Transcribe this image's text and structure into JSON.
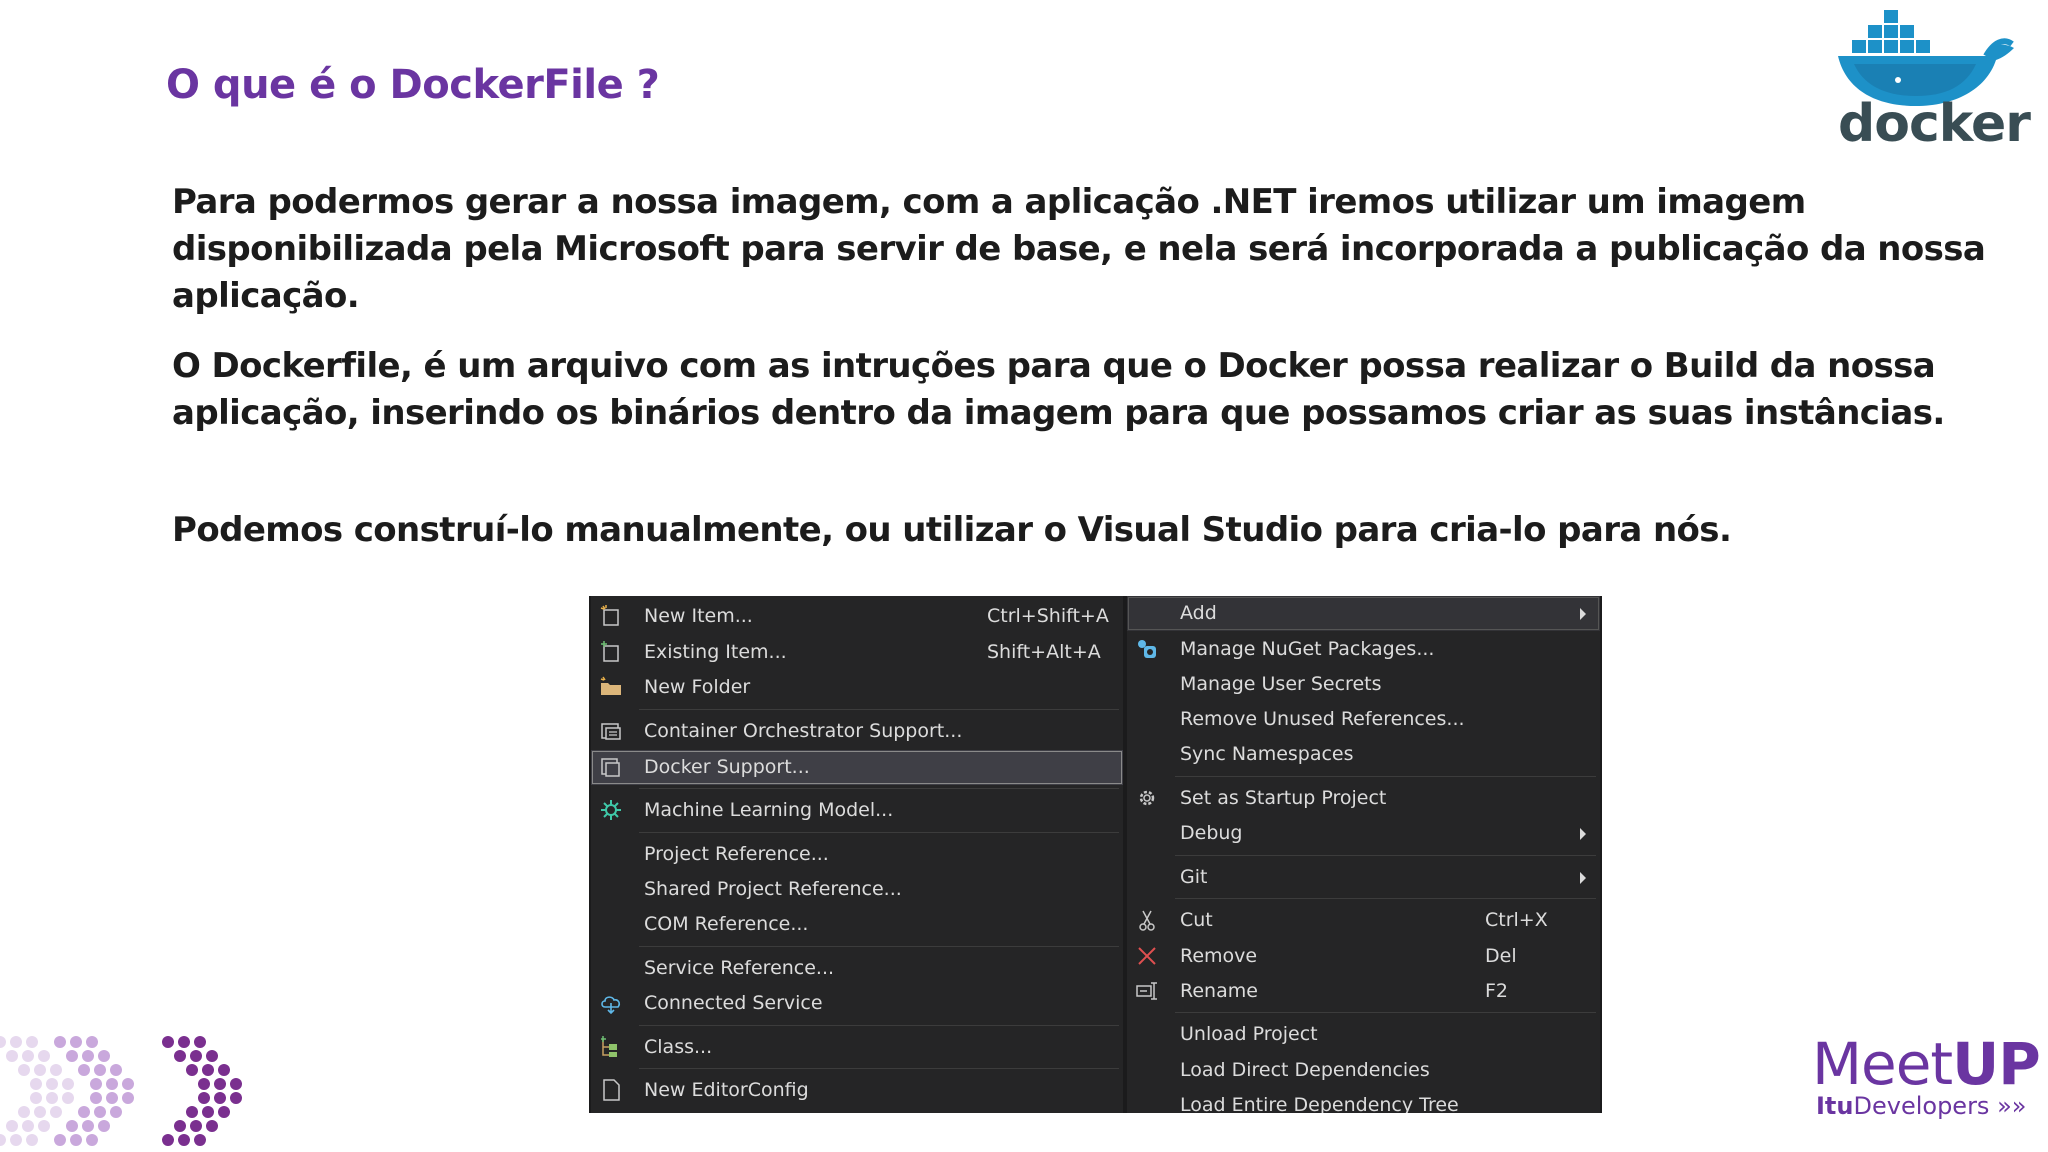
{
  "slide": {
    "title": "O que é o DockerFile ?",
    "paragraphs": [
      "Para podermos gerar a nossa imagem, com a aplicação .NET iremos utilizar um imagem disponibilizada pela Microsoft para servir de base, e nela será incorporada a publicação da nossa aplicação.",
      "O Dockerfile, é um arquivo com as intruções para que o Docker possa realizar o Build da nossa aplicação, inserindo os binários dentro da imagem para que possamos criar as suas instâncias.",
      "Podemos construí-lo manualmente, ou utilizar o Visual Studio para cria-lo para nós."
    ]
  },
  "logos": {
    "docker_word": "docker",
    "meetup_left": "Meet",
    "meetup_right": "UP",
    "itu_bold": "Itu",
    "itu_rest": "Developers"
  },
  "colors": {
    "accent": "#6a35a1",
    "docker_blue": "#1d91c8",
    "menu_bg": "#252526"
  },
  "menu": {
    "left": [
      {
        "label": "New Item...",
        "shortcut": "Ctrl+Shift+A",
        "icon": "new-item-icon"
      },
      {
        "label": "Existing Item...",
        "shortcut": "Shift+Alt+A",
        "icon": "existing-item-icon"
      },
      {
        "label": "New Folder",
        "shortcut": "",
        "icon": "folder-icon"
      },
      {
        "label": "Container Orchestrator Support...",
        "shortcut": "",
        "icon": "container-icon"
      },
      {
        "label": "Docker Support...",
        "shortcut": "",
        "icon": "docker-support-icon",
        "selected": true
      },
      {
        "label": "Machine Learning Model...",
        "shortcut": "",
        "icon": "ml-model-icon"
      },
      {
        "label": "Project Reference...",
        "shortcut": ""
      },
      {
        "label": "Shared Project Reference...",
        "shortcut": ""
      },
      {
        "label": "COM Reference...",
        "shortcut": ""
      },
      {
        "label": "Service Reference...",
        "shortcut": ""
      },
      {
        "label": "Connected Service",
        "shortcut": "",
        "icon": "connected-service-icon"
      },
      {
        "label": "Class...",
        "shortcut": "",
        "icon": "class-icon"
      },
      {
        "label": "New EditorConfig",
        "shortcut": "",
        "icon": "editorconfig-icon"
      }
    ],
    "right": [
      {
        "label": "Add",
        "shortcut": "",
        "submenu": true,
        "highlight": true
      },
      {
        "label": "Manage NuGet Packages...",
        "shortcut": "",
        "icon": "nuget-icon"
      },
      {
        "label": "Manage User Secrets",
        "shortcut": ""
      },
      {
        "label": "Remove Unused References...",
        "shortcut": ""
      },
      {
        "label": "Sync Namespaces",
        "shortcut": ""
      },
      {
        "label": "Set as Startup Project",
        "shortcut": "",
        "icon": "gear-icon"
      },
      {
        "label": "Debug",
        "shortcut": "",
        "submenu": true
      },
      {
        "label": "Git",
        "shortcut": "",
        "submenu": true
      },
      {
        "label": "Cut",
        "shortcut": "Ctrl+X",
        "icon": "scissors-icon"
      },
      {
        "label": "Remove",
        "shortcut": "Del",
        "icon": "remove-x-icon"
      },
      {
        "label": "Rename",
        "shortcut": "F2",
        "icon": "rename-icon"
      },
      {
        "label": "Unload Project",
        "shortcut": ""
      },
      {
        "label": "Load Direct Dependencies",
        "shortcut": ""
      },
      {
        "label": "Load Entire Dependency Tree",
        "shortcut": ""
      }
    ]
  }
}
